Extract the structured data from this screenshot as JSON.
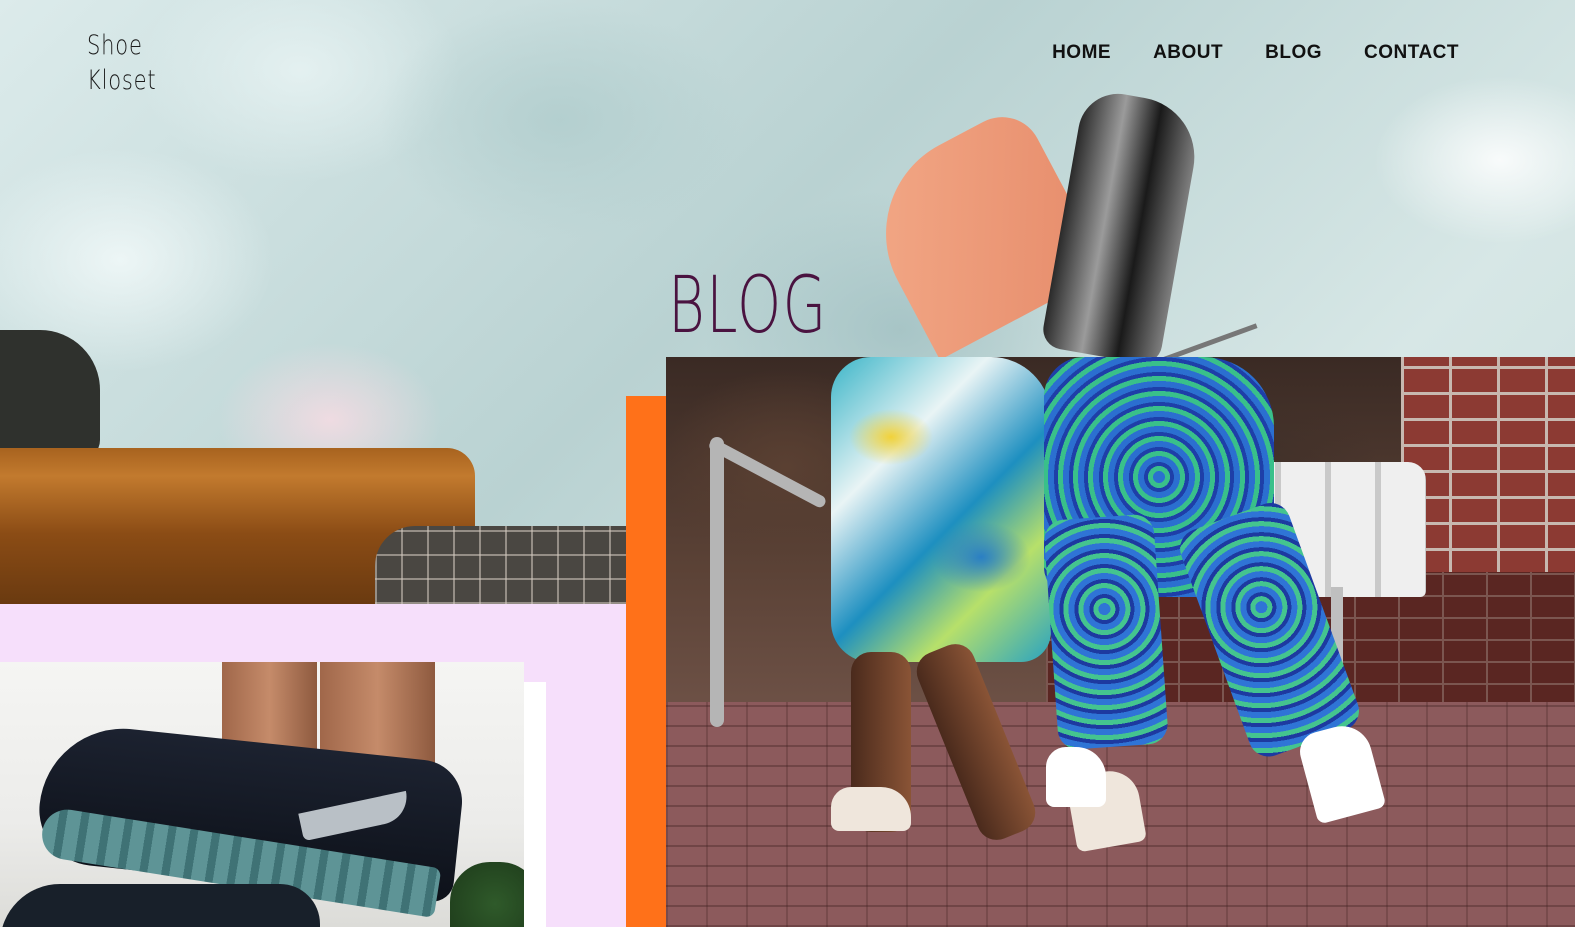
{
  "brand": {
    "line1": "Shoe",
    "line2": "Kloset"
  },
  "nav": {
    "items": [
      "HOME",
      "ABOUT",
      "BLOG",
      "CONTACT"
    ]
  },
  "page": {
    "title": "BLOG"
  },
  "colors": {
    "accent_orange": "#ff7119",
    "accent_pink": "#f6dffb",
    "title_color": "#4a1340"
  }
}
